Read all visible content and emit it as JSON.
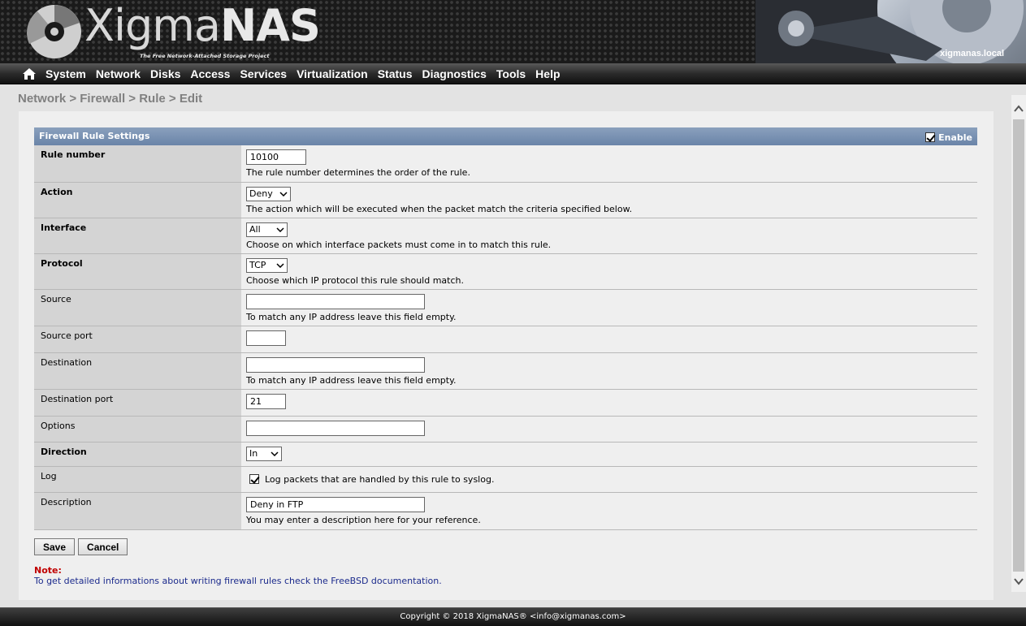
{
  "header": {
    "logo_text_main": "Xigma",
    "logo_text_accent": "NAS",
    "logo_registered": "®",
    "logo_tagline": "The Free Network-Attached Storage Project",
    "hostname": "xigmanas.local"
  },
  "nav": {
    "items": [
      "System",
      "Network",
      "Disks",
      "Access",
      "Services",
      "Virtualization",
      "Status",
      "Diagnostics",
      "Tools",
      "Help"
    ]
  },
  "breadcrumb": "Network > Firewall > Rule > Edit",
  "form": {
    "title": "Firewall Rule Settings",
    "enable_label": "Enable",
    "enable_checked": true,
    "rule_number": {
      "label": "Rule number",
      "value": "10100",
      "hint": "The rule number determines the order of the rule."
    },
    "action": {
      "label": "Action",
      "value": "Deny",
      "hint": "The action which will be executed when the packet match the criteria specified below."
    },
    "interface": {
      "label": "Interface",
      "value": "All",
      "hint": "Choose on which interface packets must come in to match this rule."
    },
    "protocol": {
      "label": "Protocol",
      "value": "TCP",
      "hint": "Choose which IP protocol this rule should match."
    },
    "source": {
      "label": "Source",
      "value": "",
      "hint": "To match any IP address leave this field empty."
    },
    "source_port": {
      "label": "Source port",
      "value": ""
    },
    "destination": {
      "label": "Destination",
      "value": "",
      "hint": "To match any IP address leave this field empty."
    },
    "destination_port": {
      "label": "Destination port",
      "value": "21"
    },
    "options": {
      "label": "Options",
      "value": ""
    },
    "direction": {
      "label": "Direction",
      "value": "In"
    },
    "log": {
      "label": "Log",
      "checked": true,
      "text": "Log packets that are handled by this rule to syslog."
    },
    "description": {
      "label": "Description",
      "value": "Deny in FTP",
      "hint": "You may enter a description here for your reference."
    }
  },
  "buttons": {
    "save": "Save",
    "cancel": "Cancel"
  },
  "note": {
    "label": "Note:",
    "text": "To get detailed informations about writing firewall rules check the FreeBSD documentation."
  },
  "footer": "Copyright © 2018 XigmaNAS® <info@xigmanas.com>",
  "colors": {
    "section_header": "#7891b3",
    "label_bg": "#d4d4d4",
    "note_label": "#c00000",
    "note_text": "#1b2a8c"
  }
}
